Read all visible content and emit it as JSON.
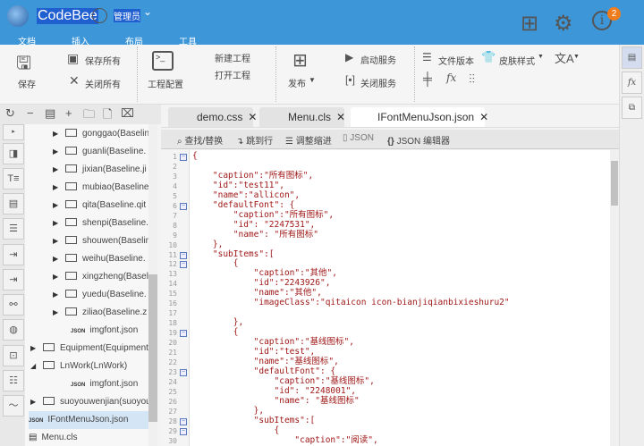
{
  "app": {
    "name": "CodeBee",
    "user": "管理员",
    "notification_count": "2"
  },
  "menu_tabs": [
    "文档",
    "插入",
    "布局",
    "工具"
  ],
  "ribbon": {
    "save": "保存",
    "save_all": "保存所有",
    "close_all": "关闭所有",
    "project_config": "工程配置",
    "new_project": "新建工程",
    "open_project": "打开工程",
    "publish": "发布",
    "start_service": "启动服务",
    "stop_service": "关闭服务",
    "file_version": "文件版本",
    "skin_style": "皮肤样式"
  },
  "tree": {
    "items": [
      {
        "label": "gonggao(Baseline",
        "type": "folder",
        "indent": 2
      },
      {
        "label": "guanli(Baseline.",
        "type": "folder",
        "indent": 2
      },
      {
        "label": "jixian(Baseline.ji",
        "type": "folder",
        "indent": 2
      },
      {
        "label": "mubiao(Baseline",
        "type": "folder",
        "indent": 2
      },
      {
        "label": "qita(Baseline.qit",
        "type": "folder",
        "indent": 2
      },
      {
        "label": "shenpi(Baseline.",
        "type": "folder",
        "indent": 2
      },
      {
        "label": "shouwen(Baselin",
        "type": "folder",
        "indent": 2
      },
      {
        "label": "weihu(Baseline.",
        "type": "folder",
        "indent": 2
      },
      {
        "label": "xingzheng(Basel",
        "type": "folder",
        "indent": 2
      },
      {
        "label": "yuedu(Baseline.",
        "type": "folder",
        "indent": 2
      },
      {
        "label": "ziliao(Baseline.z",
        "type": "folder",
        "indent": 2
      },
      {
        "label": "imgfont.json",
        "type": "json",
        "indent": 2
      },
      {
        "label": "Equipment(Equipment",
        "type": "folder",
        "indent": 1
      },
      {
        "label": "LnWork(LnWork)",
        "type": "folder-open",
        "indent": 1
      },
      {
        "label": "imgfont.json",
        "type": "json",
        "indent": 2
      },
      {
        "label": "suoyouwenjian(suoyou",
        "type": "folder",
        "indent": 1
      },
      {
        "label": "IFontMenuJson.json",
        "type": "json",
        "indent": 0,
        "selected": true
      },
      {
        "label": "Menu.cls",
        "type": "cls",
        "indent": 0
      }
    ]
  },
  "tabs": [
    {
      "label": "demo.css"
    },
    {
      "label": "Menu.cls"
    },
    {
      "label": "IFontMenuJson.json",
      "active": true
    }
  ],
  "editor_toolbar": {
    "find": "查找/替换",
    "goto": "跳到行",
    "indent": "调整缩进",
    "json": "JSON",
    "json_editor": "JSON 编辑器"
  },
  "code_lines": [
    "{",
    "",
    "    \"caption\":\"所有图标\",",
    "    \"id\":\"test11\",",
    "    \"name\":\"allicon\",",
    "    \"defaultFont\": {",
    "        \"caption\":\"所有图标\",",
    "        \"id\": \"2247531\",",
    "        \"name\": \"所有图标\"",
    "    },",
    "    \"subItems\":[",
    "        {",
    "            \"caption\":\"其他\",",
    "            \"id\":\"2243926\",",
    "            \"name\":\"其他\",",
    "            \"imageClass\":\"qitaicon icon-bianjiqianbixieshuru2\"",
    "",
    "        },",
    "        {",
    "            \"caption\":\"基线图标\",",
    "            \"id\":\"test\",",
    "            \"name\":\"基线图标\",",
    "            \"defaultFont\": {",
    "                \"caption\":\"基线图标\",",
    "                \"id\": \"2248001\",",
    "                \"name\": \"基线图标\"",
    "            },",
    "            \"subItems\":[",
    "                {",
    "                    \"caption\":\"阅读\","
  ],
  "fold_lines": [
    1,
    6,
    11,
    12,
    19,
    23,
    28,
    29
  ]
}
